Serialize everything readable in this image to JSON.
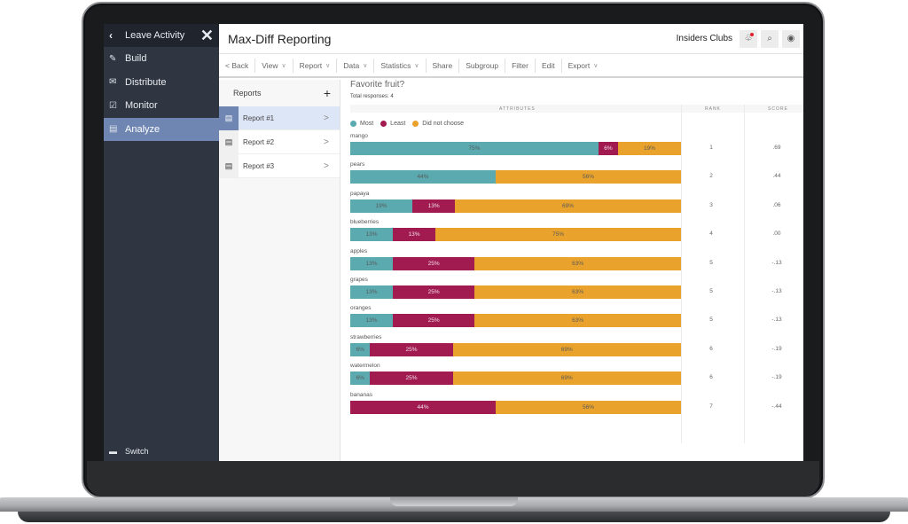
{
  "colors": {
    "most": "#5aaab0",
    "least": "#a11a50",
    "none": "#e9a22b",
    "nav_bg": "#2f3541",
    "nav_active": "#6f86b3"
  },
  "nav": {
    "leave_label": "Leave Activity",
    "back_icon": "‹",
    "close_icon": "✕",
    "items": [
      {
        "label": "Build",
        "icon": "pencil-icon",
        "glyph": "✎"
      },
      {
        "label": "Distribute",
        "icon": "envelope-icon",
        "glyph": "✉"
      },
      {
        "label": "Monitor",
        "icon": "checkbox-icon",
        "glyph": "☑"
      },
      {
        "label": "Analyze",
        "icon": "document-icon",
        "glyph": "▤",
        "active": true
      }
    ],
    "switch_label": "Switch",
    "switch_glyph": "▬"
  },
  "header": {
    "title": "Max-Diff Reporting",
    "org": "Insiders Clubs",
    "bell_glyph": "🔔",
    "search_glyph": "⌕",
    "user_glyph": "◉"
  },
  "toolbar": {
    "items": [
      {
        "label": "< Back",
        "dropdown": false
      },
      {
        "label": "View",
        "dropdown": true
      },
      {
        "label": "Report",
        "dropdown": true
      },
      {
        "label": "Data",
        "dropdown": true
      },
      {
        "label": "Statistics",
        "dropdown": true
      },
      {
        "label": "Share",
        "dropdown": false
      },
      {
        "label": "Subgroup",
        "dropdown": false
      },
      {
        "label": "Filter",
        "dropdown": false
      },
      {
        "label": "Edit",
        "dropdown": false
      },
      {
        "label": "Export",
        "dropdown": true
      }
    ],
    "chevron": "∨"
  },
  "reports": {
    "title": "Reports",
    "add_glyph": "+",
    "arrow_glyph": ">",
    "doc_glyph": "▤",
    "items": [
      {
        "label": "Report #1",
        "active": true
      },
      {
        "label": "Report #2",
        "active": false
      },
      {
        "label": "Report #3",
        "active": false
      }
    ]
  },
  "main": {
    "question": "Favorite fruit?",
    "total_label": "Total responses: 4",
    "col_attributes": "ATTRIBUTES",
    "col_rank": "RANK",
    "col_score": "SCORE",
    "legend": [
      "Most",
      "Least",
      "Did not choose"
    ]
  },
  "chart_data": {
    "type": "bar",
    "stacked": true,
    "orientation": "horizontal",
    "title": "Favorite fruit?",
    "series_names": [
      "Most",
      "Least",
      "Did not choose"
    ],
    "categories": [
      "mango",
      "pears",
      "papaya",
      "blueberries",
      "apples",
      "grapes",
      "oranges",
      "strawberries",
      "watermelon",
      "bananas"
    ],
    "series": [
      {
        "name": "Most",
        "values": [
          75,
          44,
          19,
          13,
          13,
          13,
          13,
          6,
          6,
          0
        ]
      },
      {
        "name": "Least",
        "values": [
          6,
          0,
          13,
          13,
          25,
          25,
          25,
          25,
          25,
          44
        ]
      },
      {
        "name": "Did not choose",
        "values": [
          19,
          56,
          69,
          75,
          63,
          63,
          63,
          69,
          69,
          56
        ]
      }
    ],
    "rank": [
      1,
      2,
      3,
      4,
      5,
      5,
      5,
      6,
      6,
      7
    ],
    "score": [
      ".69",
      ".44",
      ".06",
      ".00",
      "-.13",
      "-.13",
      "-.13",
      "-.19",
      "-.19",
      "-.44"
    ],
    "unit": "%"
  }
}
